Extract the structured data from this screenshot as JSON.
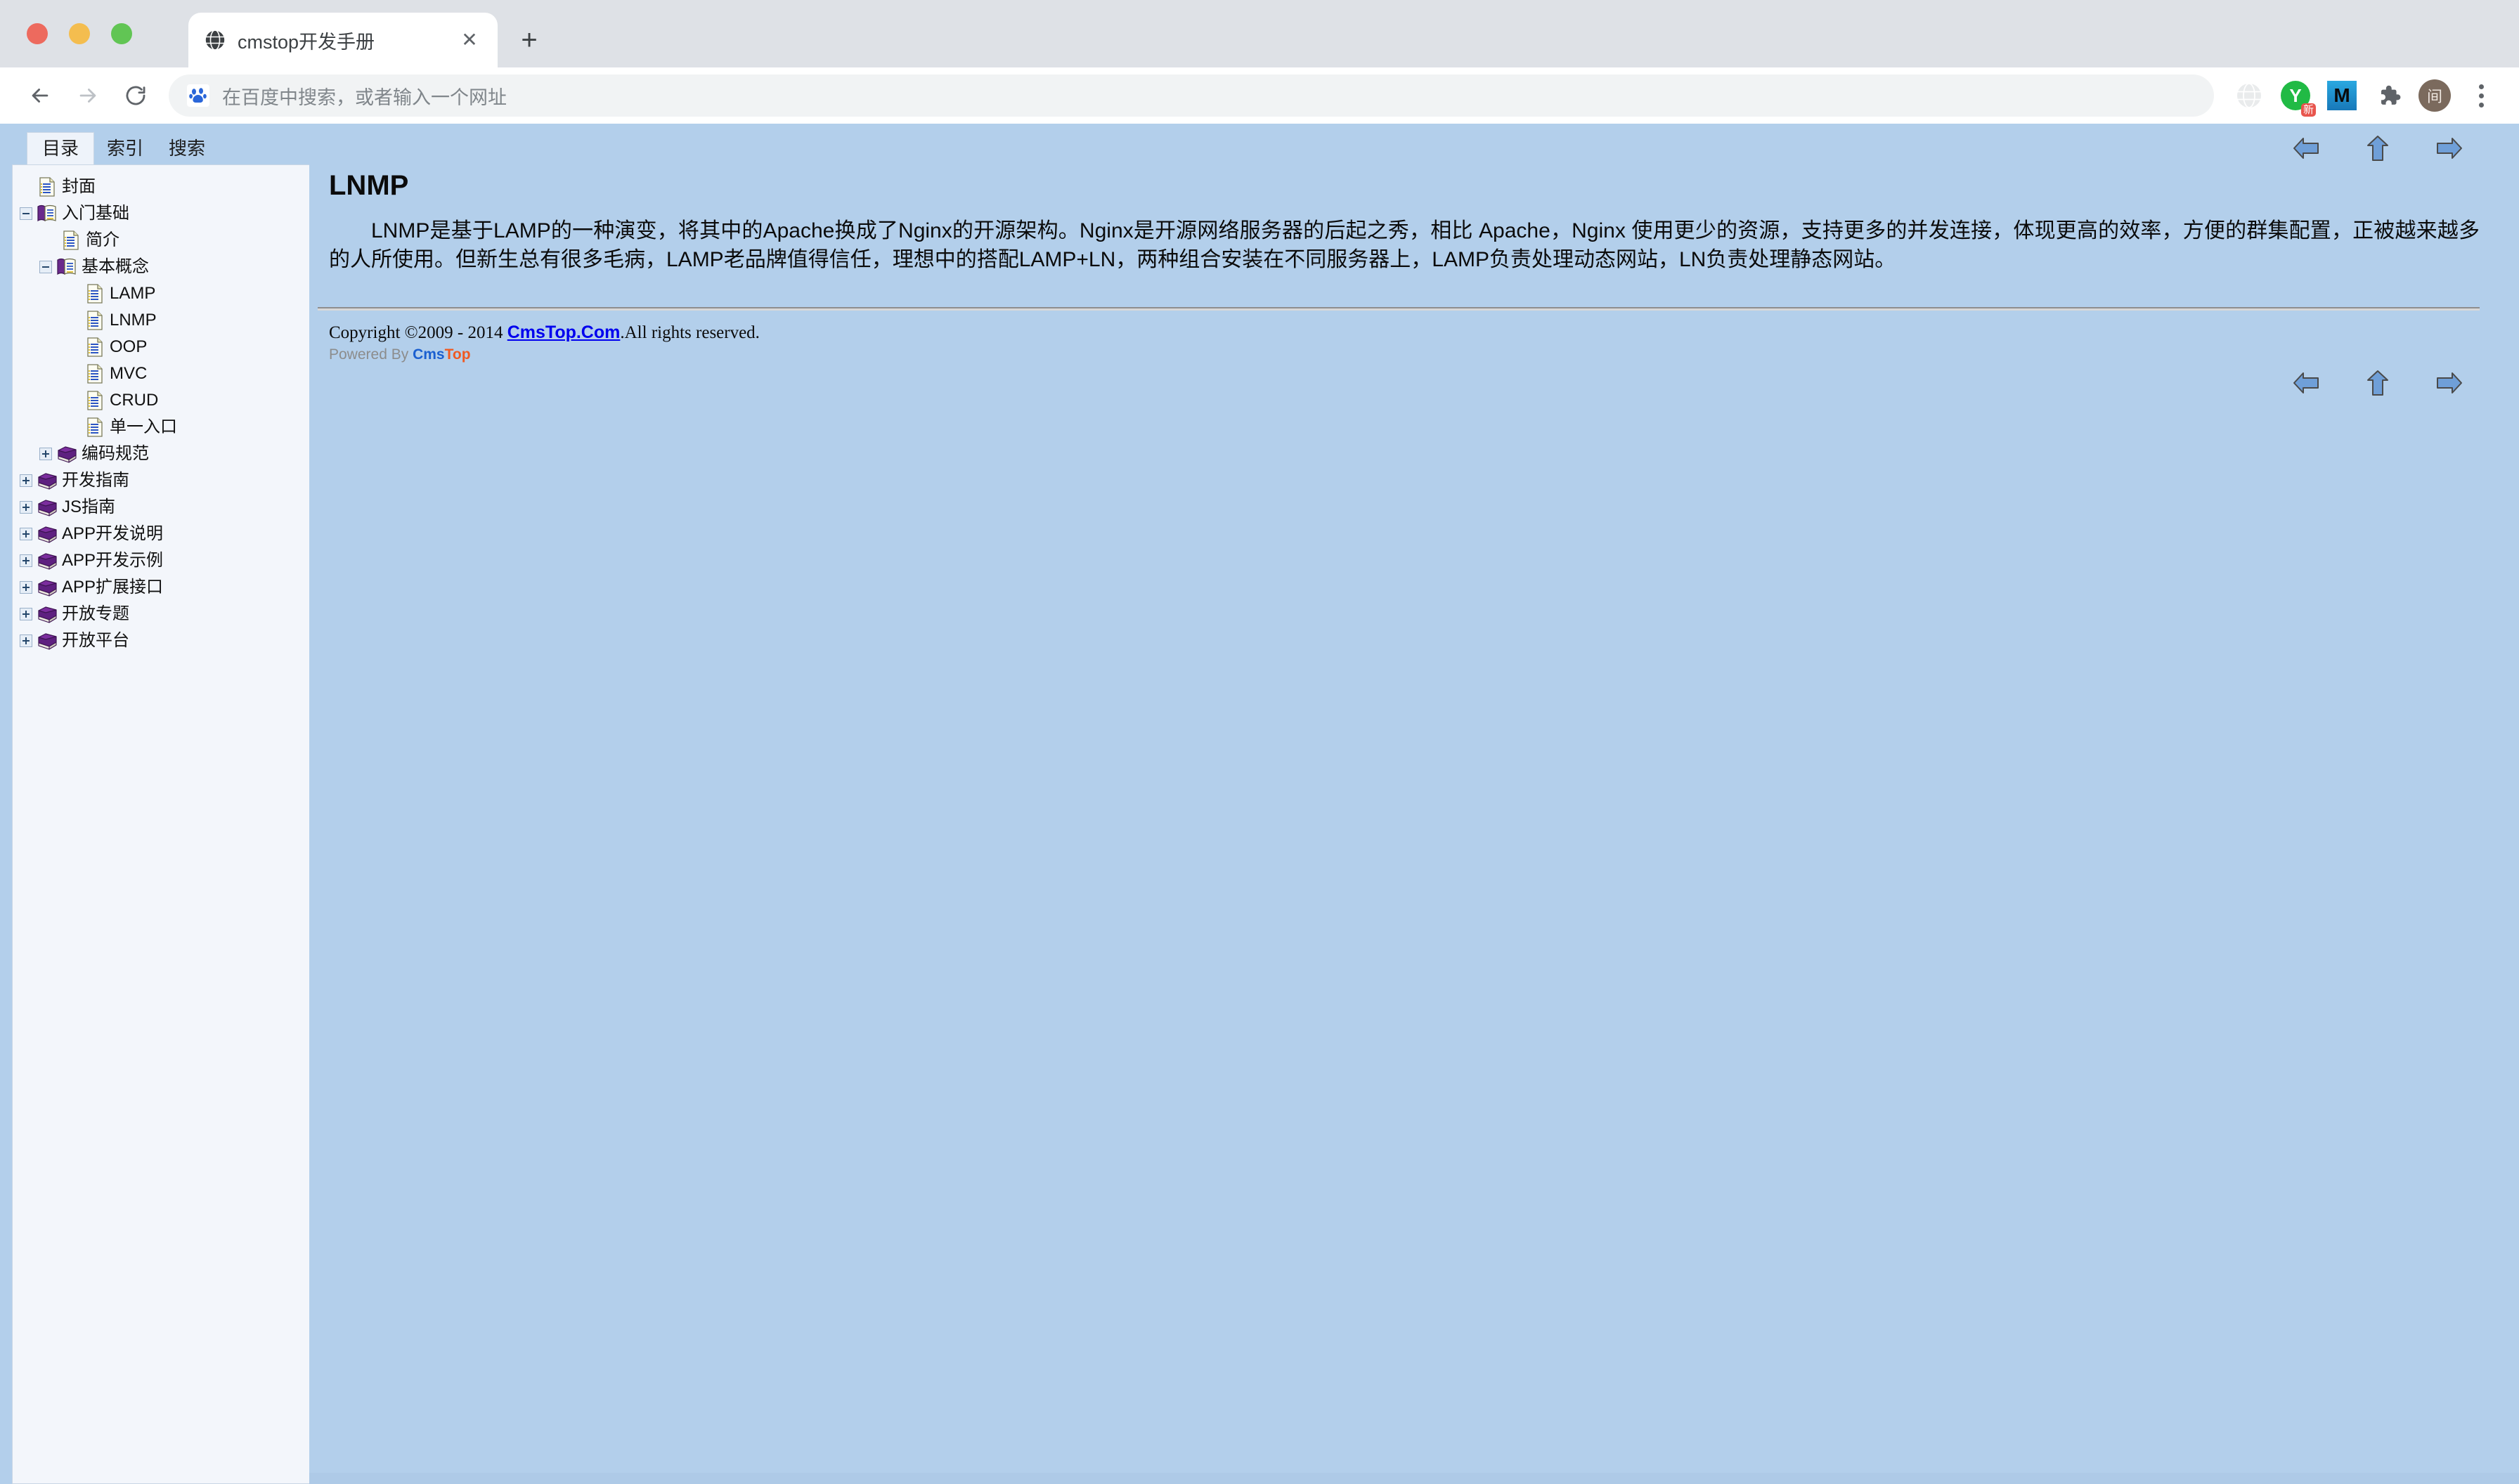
{
  "browser": {
    "window_controls": [
      "close",
      "minimize",
      "maximize"
    ],
    "tab": {
      "title": "cmstop开发手册",
      "favicon": "globe-icon",
      "close_label": "✕"
    },
    "new_tab_label": "+",
    "back_label": "←",
    "forward_label": "→",
    "reload_label": "⟳",
    "omnibox": {
      "placeholder": "在百度中搜索，或者输入一个网址",
      "value": "",
      "search_engine_icon": "baidu-paw-icon"
    },
    "extensions": [
      {
        "name": "globe-extension-icon",
        "label": ""
      },
      {
        "name": "youdao-extension-icon",
        "label": "Y",
        "badge": "新"
      },
      {
        "name": "m-extension-icon",
        "label": "M"
      },
      {
        "name": "puzzle-extensions-icon",
        "label": ""
      },
      {
        "name": "profile-avatar",
        "label": "间"
      }
    ],
    "menu_label": "⋮"
  },
  "nav": {
    "tabs": [
      {
        "label": "目录",
        "active": true
      },
      {
        "label": "索引",
        "active": false
      },
      {
        "label": "搜索",
        "active": false
      }
    ],
    "tree": [
      {
        "label": "封面",
        "level": 1,
        "icon": "page-icon",
        "toggle": "none"
      },
      {
        "label": "入门基础",
        "level": 0,
        "icon": "open-book-icon",
        "toggle": "minus"
      },
      {
        "label": "简介",
        "level": 2,
        "icon": "page-icon",
        "toggle": "none"
      },
      {
        "label": "基本概念",
        "level": 1,
        "icon": "open-book-icon",
        "toggle": "minus",
        "indent": 34
      },
      {
        "label": "LAMP",
        "level": 3,
        "icon": "page-icon",
        "toggle": "none"
      },
      {
        "label": "LNMP",
        "level": 3,
        "icon": "page-icon",
        "toggle": "none",
        "selected": true
      },
      {
        "label": "OOP",
        "level": 3,
        "icon": "page-icon",
        "toggle": "none"
      },
      {
        "label": "MVC",
        "level": 3,
        "icon": "page-icon",
        "toggle": "none"
      },
      {
        "label": "CRUD",
        "level": 3,
        "icon": "page-icon",
        "toggle": "none"
      },
      {
        "label": "单一入口",
        "level": 3,
        "icon": "page-icon",
        "toggle": "none"
      },
      {
        "label": "编码规范",
        "level": 1,
        "icon": "book-icon",
        "toggle": "plus",
        "indent": 34
      },
      {
        "label": "开发指南",
        "level": 0,
        "icon": "book-icon",
        "toggle": "plus"
      },
      {
        "label": "JS指南",
        "level": 0,
        "icon": "book-icon",
        "toggle": "plus"
      },
      {
        "label": "APP开发说明",
        "level": 0,
        "icon": "book-icon",
        "toggle": "plus"
      },
      {
        "label": "APP开发示例",
        "level": 0,
        "icon": "book-icon",
        "toggle": "plus"
      },
      {
        "label": "APP扩展接口",
        "level": 0,
        "icon": "book-icon",
        "toggle": "plus"
      },
      {
        "label": "开放专题",
        "level": 0,
        "icon": "book-icon",
        "toggle": "plus"
      },
      {
        "label": "开放平台",
        "level": 0,
        "icon": "book-icon",
        "toggle": "plus"
      }
    ]
  },
  "doc": {
    "nav_arrows": [
      {
        "name": "prev-page-arrow",
        "glyph": "left"
      },
      {
        "name": "up-page-arrow",
        "glyph": "up"
      },
      {
        "name": "next-page-arrow",
        "glyph": "right"
      }
    ],
    "title": "LNMP",
    "body": "LNMP是基于LAMP的一种演变，将其中的Apache换成了Nginx的开源架构。Nginx是开源网络服务器的后起之秀，相比 Apache，Nginx 使用更少的资源，支持更多的并发连接，体现更高的效率，方便的群集配置，正被越来越多的人所使用。但新生总有很多毛病，LAMP老品牌值得信任，理想中的搭配LAMP+LN，两种组合安装在不同服务器上，LAMP负责处理动态网站，LN负责处理静态网站。",
    "footer": {
      "copyright_prefix": "Copyright ©2009 - 2014 ",
      "link_text": "CmsTop.Com",
      "copyright_suffix": ".All rights reserved.",
      "powered_prefix": "Powered By ",
      "powered_brand_1": "Cms",
      "powered_brand_2": "Top"
    }
  },
  "colors": {
    "page_background": "#b3cfeb",
    "tree_background": "#f3f6fb",
    "link": "#0000ee",
    "brand_blue": "#1a5fd0",
    "brand_orange": "#ef5a22",
    "arrow_fill": "#6f9fd8"
  }
}
